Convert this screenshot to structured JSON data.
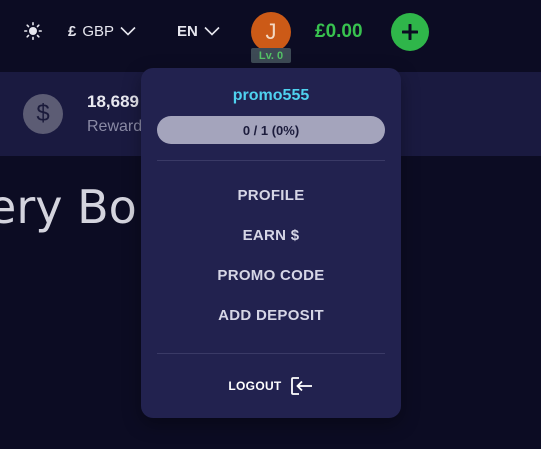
{
  "header": {
    "theme_icon": "sun-icon",
    "currency": {
      "symbol": "£",
      "code": "GBP",
      "icon": "chevron-down-icon"
    },
    "language": {
      "code": "EN",
      "icon": "chevron-down-icon"
    },
    "avatar": {
      "initial": "J",
      "level": "Lv. 0",
      "color": "#cc5a17"
    },
    "balance": "£0.00",
    "add_icon": "plus-icon"
  },
  "rewards": {
    "icon": "dollar-icon",
    "amount": "18,689",
    "label": "Reward"
  },
  "hero": {
    "title": "tery Bo"
  },
  "user_menu": {
    "username": "promo555",
    "progress": {
      "text": "0 / 1 (0%)",
      "fraction": 0
    },
    "items": [
      {
        "label": "PROFILE"
      },
      {
        "label": "EARN $"
      },
      {
        "label": "PROMO CODE"
      },
      {
        "label": "ADD DEPOSIT"
      }
    ],
    "logout": {
      "label": "LOGOUT",
      "icon": "logout-icon"
    }
  },
  "colors": {
    "background": "#0c0c23",
    "panel": "#22224f",
    "accent_green": "#38c24f",
    "username": "#4fd2ef"
  }
}
